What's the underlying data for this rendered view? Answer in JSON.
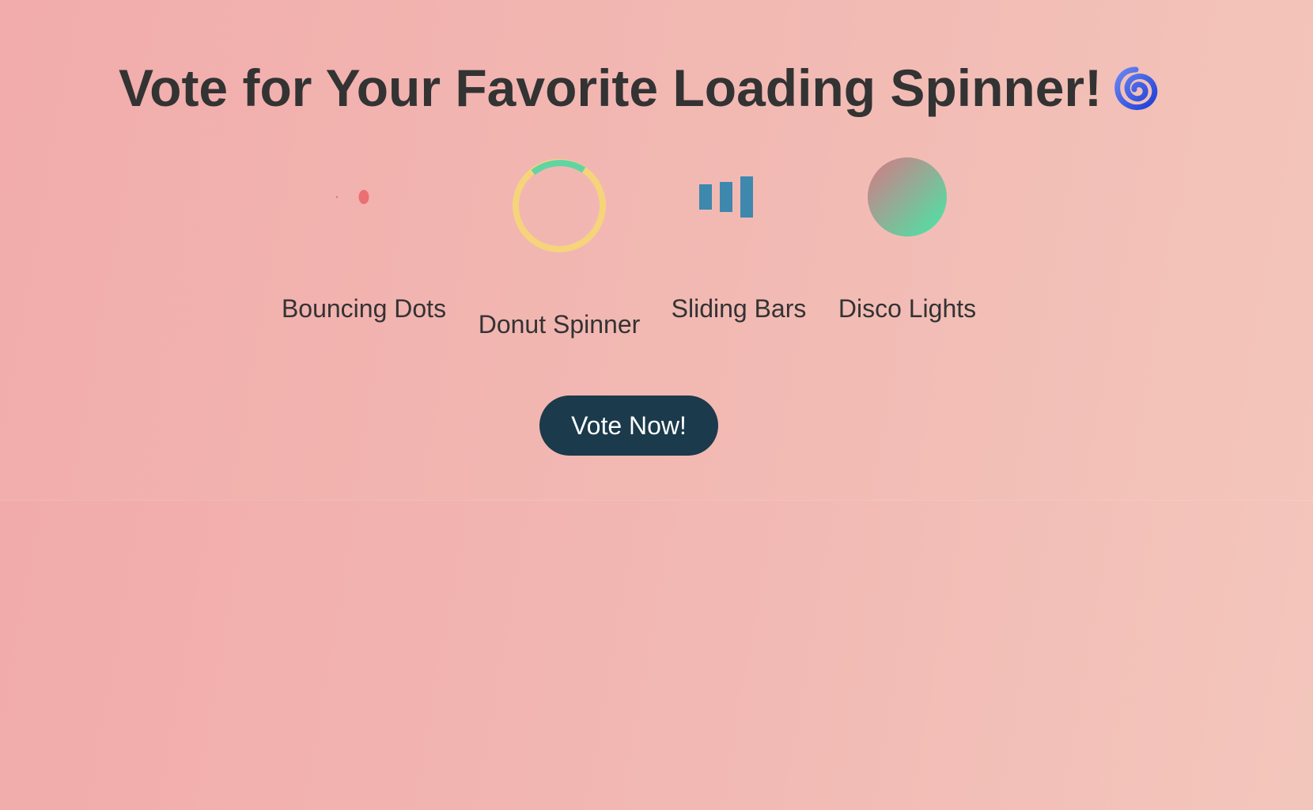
{
  "page": {
    "title": "Vote for Your Favorite Loading Spinner!",
    "title_emoji_icon": "cyclone-icon"
  },
  "spinners": [
    {
      "label": "Bouncing Dots",
      "icon": "bouncing-dots-icon",
      "color": "#ec6f73"
    },
    {
      "label": "Donut Spinner",
      "icon": "donut-spinner-icon",
      "colors": [
        "#f5d47b",
        "#62d4a3"
      ]
    },
    {
      "label": "Sliding Bars",
      "icon": "sliding-bars-icon",
      "color": "#3e88ad"
    },
    {
      "label": "Disco Lights",
      "icon": "disco-lights-icon",
      "colors": [
        "#c88388",
        "#5ad8a2"
      ]
    }
  ],
  "actions": {
    "vote_label": "Vote Now!"
  },
  "colors": {
    "text": "#333333",
    "button_bg": "#1b3a4b",
    "button_text": "#ffffff"
  }
}
